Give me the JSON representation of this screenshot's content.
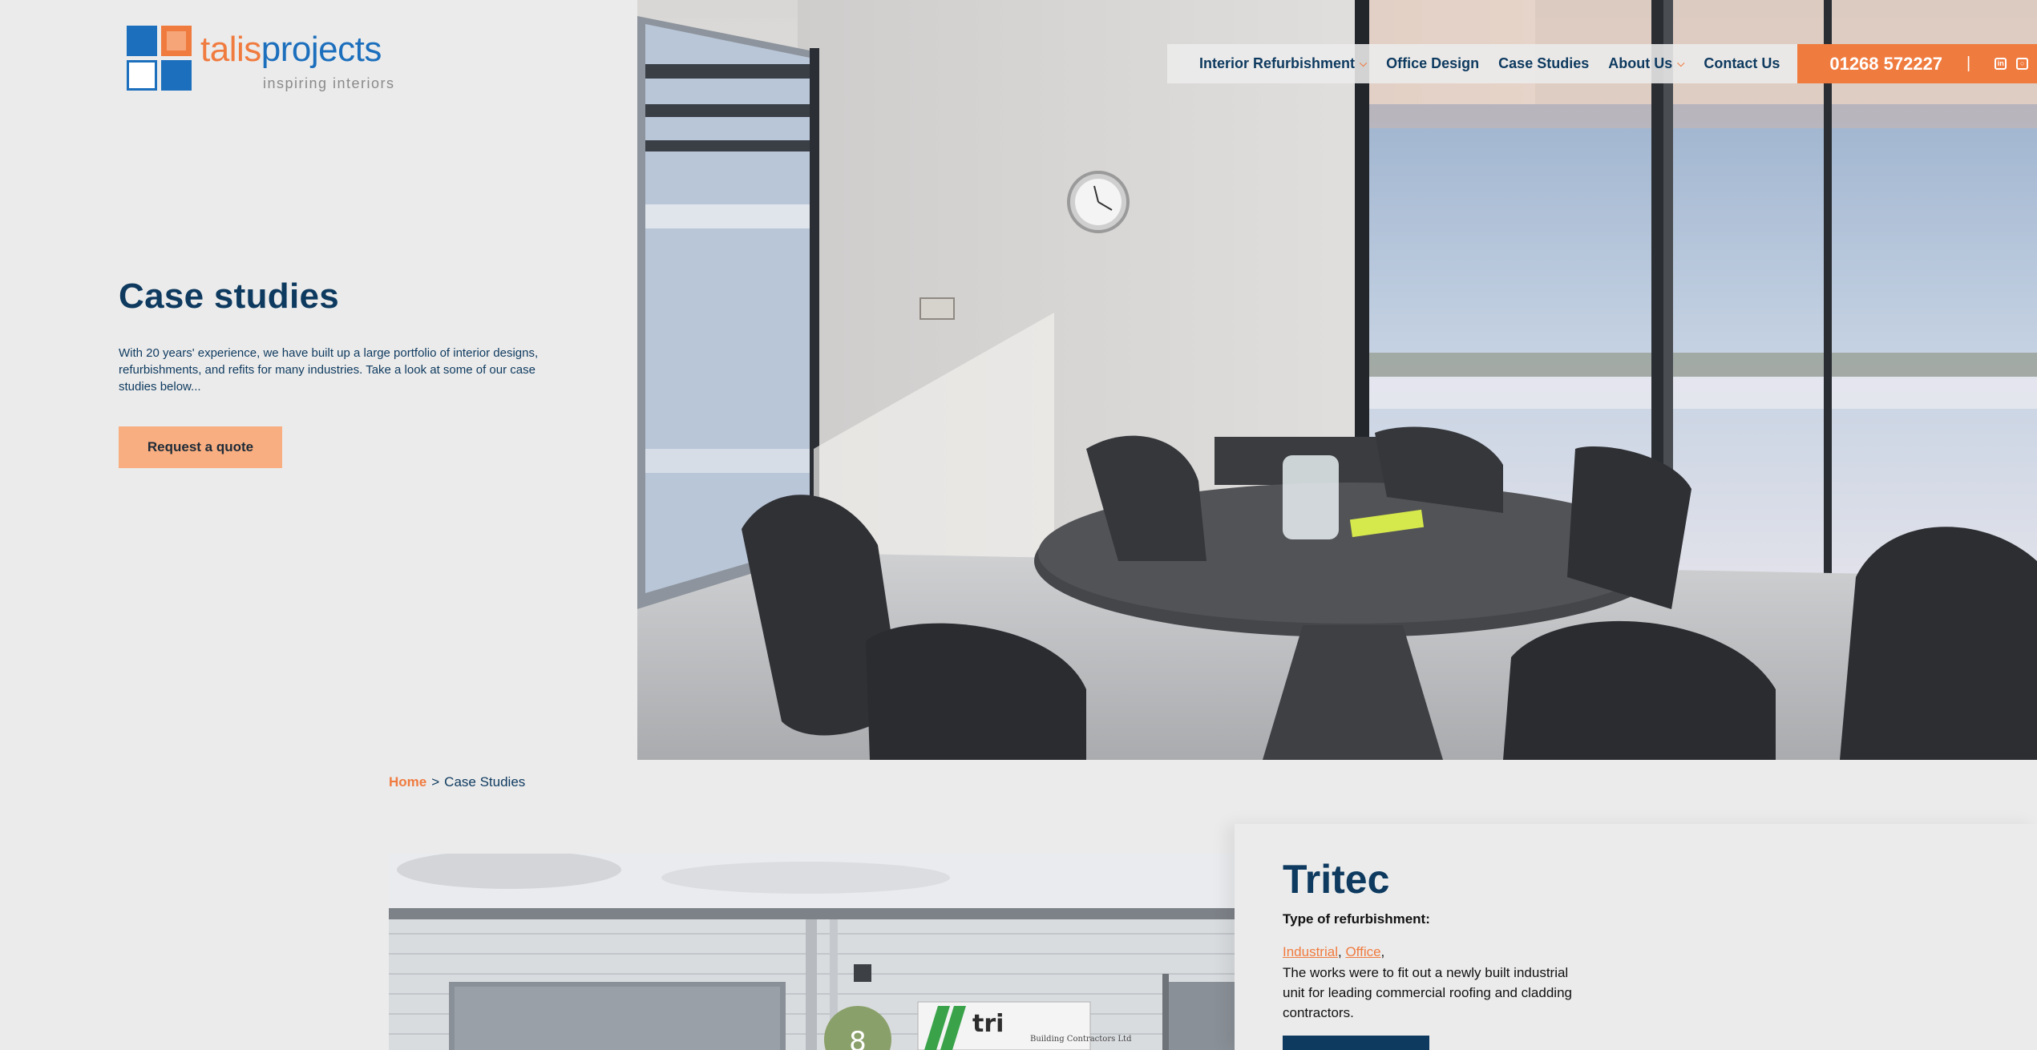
{
  "logo": {
    "brand_part1": "talis",
    "brand_part2": "projects",
    "tagline": "inspiring interiors"
  },
  "nav": {
    "items": [
      {
        "label": "Interior Refurbishment",
        "has_dropdown": true
      },
      {
        "label": "Office Design",
        "has_dropdown": false
      },
      {
        "label": "Case Studies",
        "has_dropdown": false
      },
      {
        "label": "About Us",
        "has_dropdown": true
      },
      {
        "label": "Contact Us",
        "has_dropdown": false
      }
    ],
    "phone": "01268 572227",
    "separator": "|",
    "social_icons": [
      "linkedin-icon",
      "instagram-icon",
      "facebook-icon"
    ]
  },
  "hero": {
    "title": "Case studies",
    "description": "With 20 years' experience, we have built up a large portfolio of interior designs, refurbishments, and refits for many industries. Take a look at some of our case studies below...",
    "cta_label": "Request a quote",
    "image": "meeting-room-photo"
  },
  "breadcrumb": {
    "home": "Home",
    "separator": ">",
    "current": "Case Studies"
  },
  "case_study": {
    "title": "Tritec",
    "type_label": "Type of refurbishment:",
    "tags": [
      "Industrial",
      "Office"
    ],
    "tag_separator": ",",
    "description": "The works were to fit out a newly built industrial unit for leading commercial roofing and cladding contractors.",
    "image": "industrial-unit-photo",
    "sign_text": "tri",
    "sign_subtext": "Building Contractors Ltd",
    "unit_number": "8"
  },
  "colors": {
    "navy": "#0e3a5f",
    "orange": "#f07b3f",
    "peach": "#f8ae80",
    "background": "#ebebeb",
    "logo_blue": "#1c6fbd"
  }
}
